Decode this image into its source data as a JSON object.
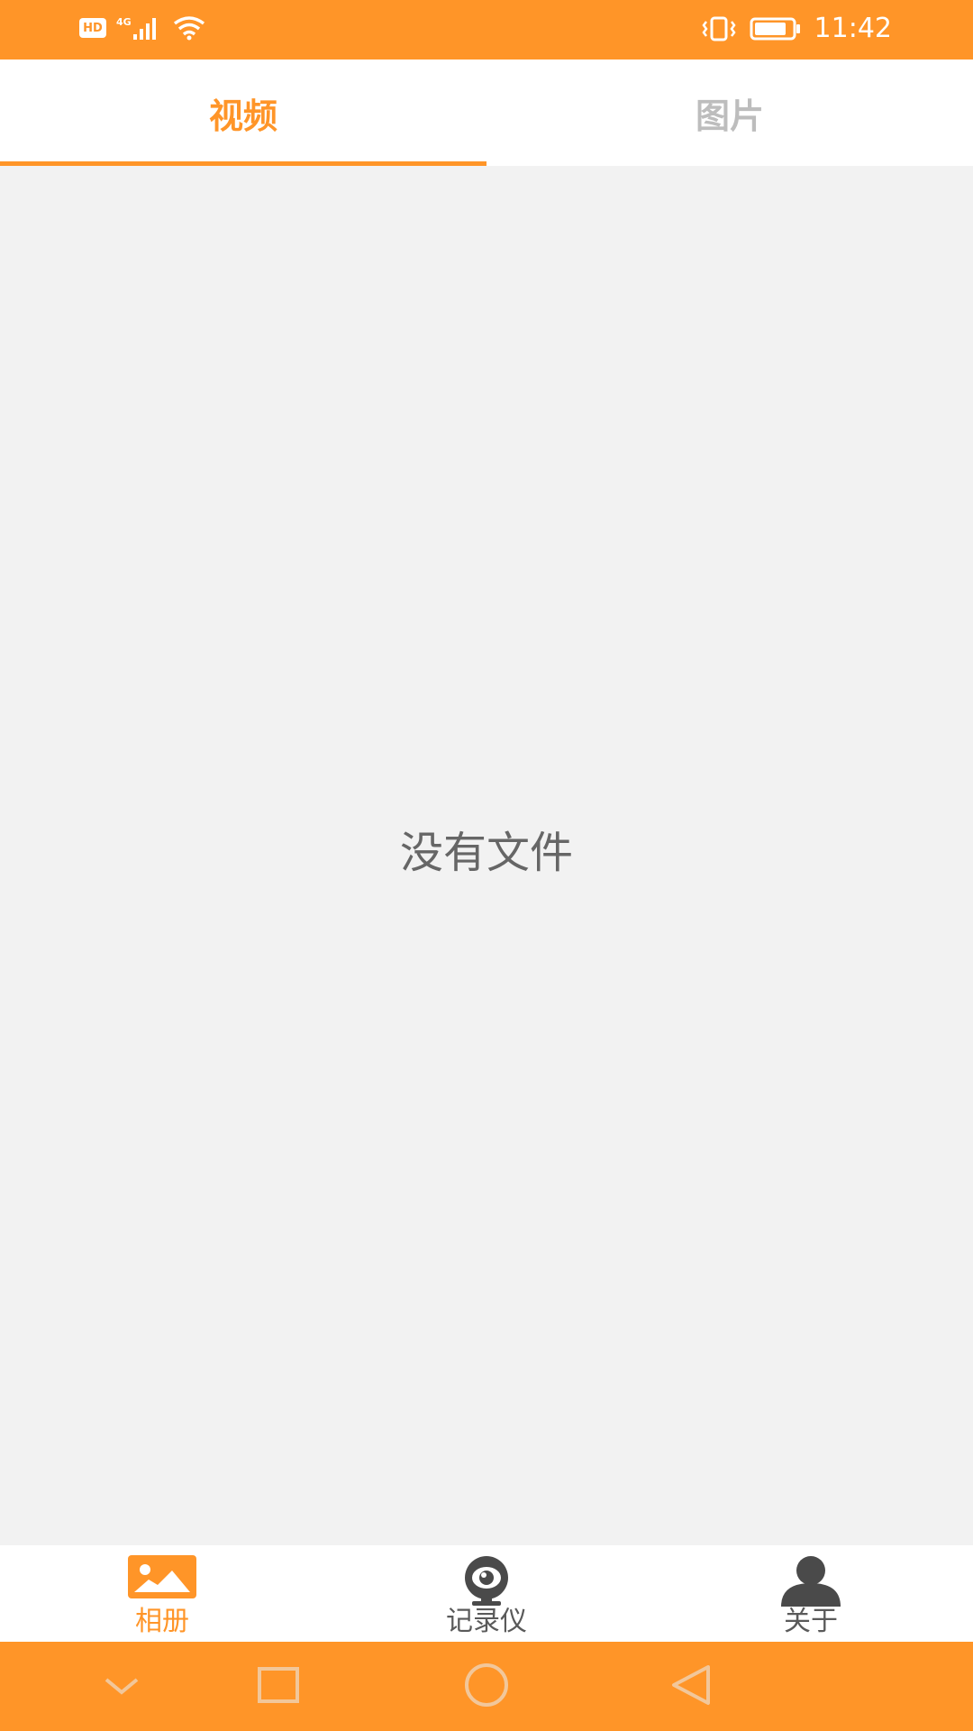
{
  "status_bar": {
    "hd_label": "HD",
    "network": "4G",
    "time": "11:42"
  },
  "tabs": [
    {
      "label": "视频",
      "active": true
    },
    {
      "label": "图片",
      "active": false
    }
  ],
  "content": {
    "empty_message": "没有文件"
  },
  "bottom_nav": [
    {
      "label": "相册",
      "icon": "album-icon",
      "active": true
    },
    {
      "label": "记录仪",
      "icon": "camera-icon",
      "active": false
    },
    {
      "label": "关于",
      "icon": "person-icon",
      "active": false
    }
  ],
  "colors": {
    "accent": "#ff9528",
    "tab_inactive": "#bdbdbd",
    "background": "#f2f2f2",
    "nav_inactive": "#5a5a5a"
  }
}
